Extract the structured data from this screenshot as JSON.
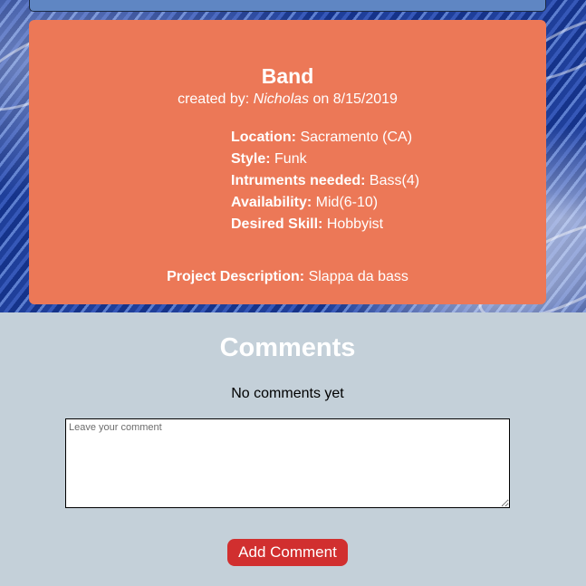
{
  "project": {
    "title": "Band",
    "created_by_label": "created by:",
    "creator": "Nicholas",
    "on_label": "on",
    "date": "8/15/2019",
    "details": [
      {
        "label": "Location:",
        "value": "Sacramento (CA)"
      },
      {
        "label": "Style:",
        "value": "Funk"
      },
      {
        "label": "Intruments needed:",
        "value": "Bass(4)"
      },
      {
        "label": "Availability:",
        "value": "Mid(6-10)"
      },
      {
        "label": "Desired Skill:",
        "value": "Hobbyist"
      }
    ],
    "description_label": "Project Description:",
    "description": "Slappa da bass"
  },
  "comments": {
    "title": "Comments",
    "empty_text": "No comments yet",
    "placeholder": "Leave your comment",
    "submit_label": "Add Comment"
  },
  "colors": {
    "card": "#ec7857",
    "page_background": "#c4d0d9",
    "button": "#d12f2f",
    "top_bar": "#5f86c3"
  }
}
